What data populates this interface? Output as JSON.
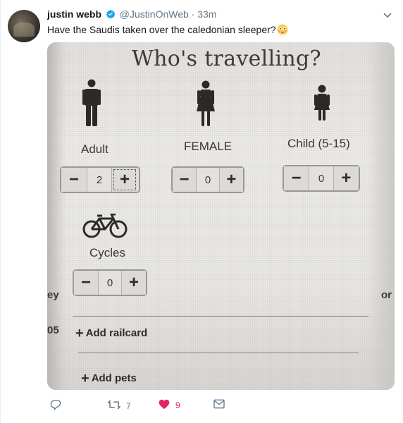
{
  "tweet": {
    "author_name": "justin webb",
    "handle": "@JustinOnWeb",
    "separator": "·",
    "time": "33m",
    "text": "Have the Saudis taken over the caledonian sleeper?",
    "replies": "",
    "retweets": "7",
    "likes": "9"
  },
  "photo": {
    "title": "Who's travelling?",
    "passengers": [
      {
        "label": "Adult",
        "value": "2",
        "icon": "man-icon"
      },
      {
        "label": "FEMALE",
        "value": "0",
        "icon": "woman-icon"
      },
      {
        "label": "Child (5-15)",
        "value": "0",
        "icon": "child-icon"
      }
    ],
    "cycles": {
      "label": "Cycles",
      "value": "0",
      "icon": "bicycle-icon"
    },
    "minus_glyph": "−",
    "plus_glyph": "+",
    "add_railcard": "Add railcard",
    "add_pets": "Add pets",
    "edge_left_1": "ey",
    "edge_left_2": "05",
    "edge_right": "or"
  },
  "colors": {
    "like": "#e0245e",
    "verified": "#1da1f2",
    "meta": "#657786"
  }
}
